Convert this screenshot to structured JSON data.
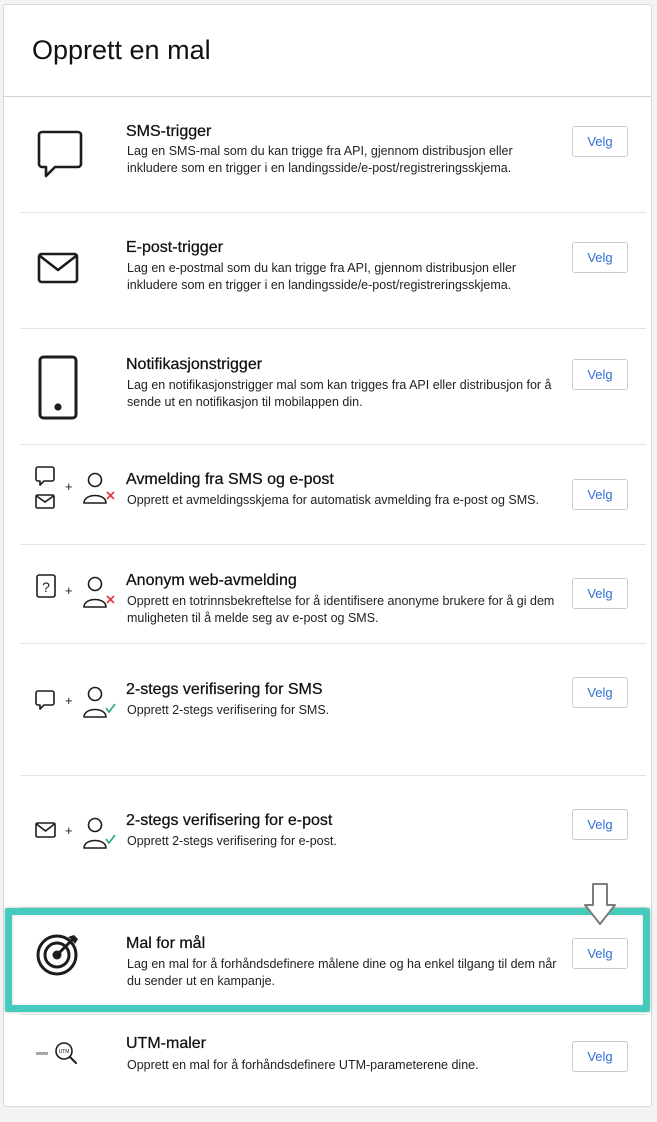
{
  "page": {
    "title": "Opprett en mal"
  },
  "templates": [
    {
      "title": "SMS-trigger",
      "description": "Lag en SMS-mal som du kan trigge fra API, gjennom distribusjon eller inkludere som en trigger i en landingsside/e-post/registreringsskjema.",
      "button": "Velg",
      "icon": "sms-bubble-icon"
    },
    {
      "title": "E-post-trigger",
      "description": "Lag en e-postmal som du kan trigge fra API, gjennom distribusjon eller inkludere som en trigger i en landingsside/e-post/registreringsskjema.",
      "button": "Velg",
      "icon": "envelope-icon"
    },
    {
      "title": "Notifikasjonstrigger",
      "description": "Lag en notifikasjonstrigger mal som kan trigges fra API eller distribusjon for å sende ut en notifikasjon til mobilappen din.",
      "button": "Velg",
      "icon": "mobile-phone-icon"
    },
    {
      "title": "Avmelding fra SMS og e-post",
      "description": "Opprett et avmeldingsskjema for automatisk avmelding fra e-post og SMS.",
      "button": "Velg",
      "icon": "unsubscribe-sms-email-icon"
    },
    {
      "title": "Anonym web-avmelding",
      "description": "Opprett en totrinnsbekreftelse for å identifisere anonyme brukere for å gi dem muligheten til å melde seg av e-post og SMS.",
      "button": "Velg",
      "icon": "anonymous-unsubscribe-icon"
    },
    {
      "title": "2-stegs verifisering for SMS",
      "description": "Opprett 2-stegs verifisering for SMS.",
      "button": "Velg",
      "icon": "sms-verify-icon"
    },
    {
      "title": "2-stegs verifisering for e-post",
      "description": "Opprett 2-stegs verifisering for e-post.",
      "button": "Velg",
      "icon": "email-verify-icon"
    },
    {
      "title": "Mal for mål",
      "description": "Lag en mal for å forhåndsdefinere målene dine og ha enkel tilgang til dem når du sender ut en kampanje.",
      "button": "Velg",
      "icon": "target-icon"
    },
    {
      "title": "UTM-maler",
      "description": "Opprett en mal for å forhåndsdefinere UTM-parameterene dine.",
      "button": "Velg",
      "icon": "utm-search-icon"
    }
  ],
  "icon_text": {
    "utm_www": "www",
    "utm_badge": "UTM"
  },
  "colors": {
    "highlight": "#44cbbd",
    "button_text": "#2f6fd6",
    "cross": "#e0383e",
    "check": "#2aa876"
  }
}
